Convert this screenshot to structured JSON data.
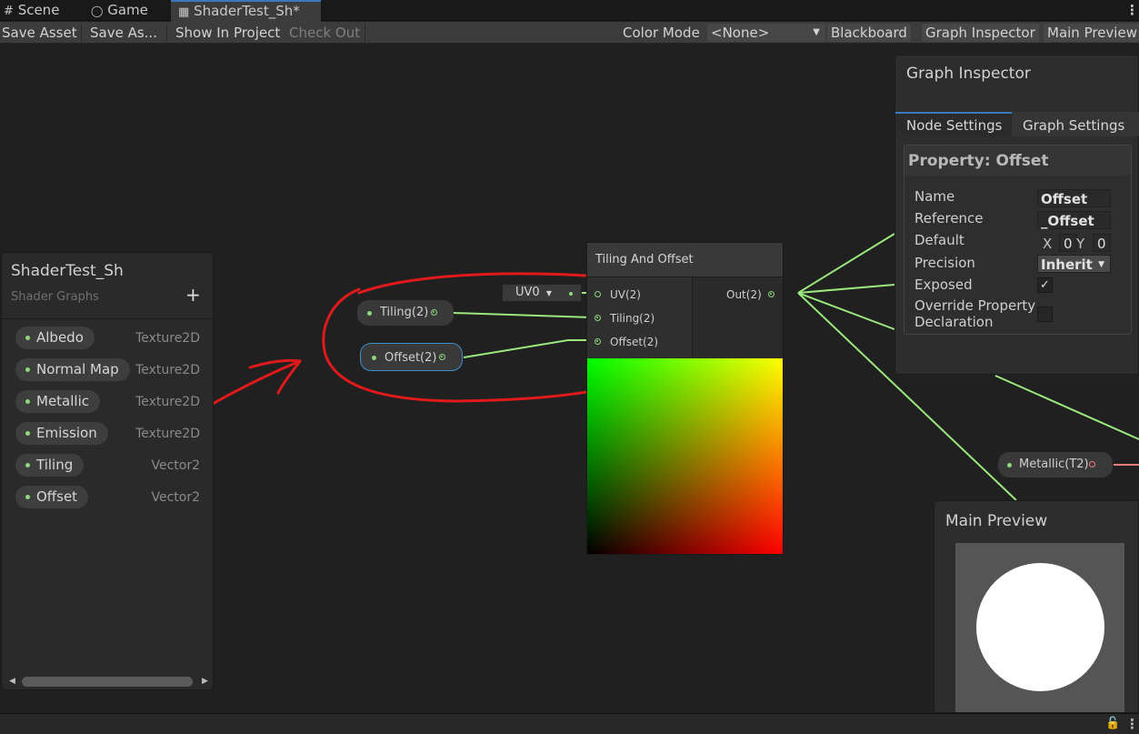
{
  "tabs": [
    {
      "label": "Scene",
      "icon": "grid-icon"
    },
    {
      "label": "Game",
      "icon": "gamepad-icon"
    },
    {
      "label": "ShaderTest_Sh*",
      "icon": "shader-icon"
    }
  ],
  "toolbar": {
    "save_asset": "Save Asset",
    "save_as": "Save As...",
    "show_in_project": "Show In Project",
    "check_out": "Check Out",
    "color_mode_label": "Color Mode",
    "color_mode_value": "<None>",
    "blackboard": "Blackboard",
    "graph_inspector": "Graph Inspector",
    "main_preview": "Main Preview"
  },
  "blackboard": {
    "title": "ShaderTest_Sh",
    "subtitle": "Shader Graphs",
    "add": "+",
    "properties": [
      {
        "name": "Albedo",
        "type": "Texture2D"
      },
      {
        "name": "Normal Map",
        "type": "Texture2D"
      },
      {
        "name": "Metallic",
        "type": "Texture2D"
      },
      {
        "name": "Emission",
        "type": "Texture2D"
      },
      {
        "name": "Tiling",
        "type": "Vector2"
      },
      {
        "name": "Offset",
        "type": "Vector2"
      }
    ]
  },
  "graph_nodes": {
    "tiling_prop": "Tiling(2)",
    "offset_prop": "Offset(2)",
    "uv_channel": "UV0",
    "metallic_prop": "Metallic(T2)"
  },
  "tiling_offset_node": {
    "title": "Tiling And Offset",
    "inputs": [
      "UV(2)",
      "Tiling(2)",
      "Offset(2)"
    ],
    "output": "Out(2)"
  },
  "inspector": {
    "title": "Graph Inspector",
    "tab_node": "Node Settings",
    "tab_graph": "Graph Settings",
    "section_title": "Property: Offset",
    "labels": {
      "name": "Name",
      "reference": "Reference",
      "default": "Default",
      "precision": "Precision",
      "exposed": "Exposed",
      "override": "Override Property Declaration"
    },
    "values": {
      "name": "Offset",
      "reference": "_Offset",
      "x_label": "X",
      "x_value": "0",
      "y_label": "Y",
      "y_value": "0",
      "precision": "Inherit",
      "exposed": true,
      "override": false
    }
  },
  "main_preview": {
    "title": "Main Preview"
  },
  "colors": {
    "wire": "#9be87e",
    "annotation": "#e0191b",
    "accent": "#3a79bb",
    "metallic_port": "#e87e7e"
  }
}
